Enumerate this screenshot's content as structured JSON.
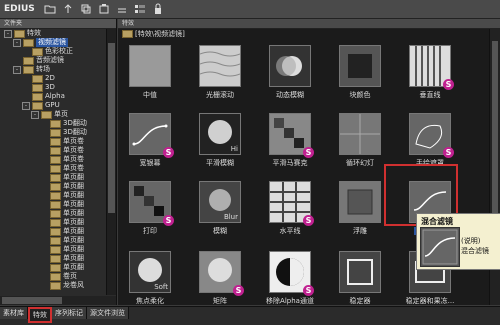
{
  "app": {
    "brand": "EDIUS"
  },
  "toolbar": [
    {
      "name": "folder-icon"
    },
    {
      "name": "up-arrow-icon"
    },
    {
      "name": "copy-icon"
    },
    {
      "name": "paste-icon"
    },
    {
      "name": "delete-icon"
    },
    {
      "name": "view-icon"
    },
    {
      "name": "lock-icon"
    }
  ],
  "left_panel": {
    "header": "文件夹",
    "tree": [
      {
        "label": "特效",
        "depth": 0,
        "expander": "-"
      },
      {
        "label": "视频滤镜",
        "depth": 1,
        "expander": "-",
        "selected": true
      },
      {
        "label": "色彩校正",
        "depth": 2,
        "expander": ""
      },
      {
        "label": "音频滤镜",
        "depth": 1,
        "expander": ""
      },
      {
        "label": "转场",
        "depth": 1,
        "expander": "-"
      },
      {
        "label": "2D",
        "depth": 2,
        "expander": ""
      },
      {
        "label": "3D",
        "depth": 2,
        "expander": ""
      },
      {
        "label": "Alpha",
        "depth": 2,
        "expander": ""
      },
      {
        "label": "GPU",
        "depth": 2,
        "expander": "-"
      },
      {
        "label": "单页",
        "depth": 3,
        "expander": "-"
      },
      {
        "label": "3D翻动",
        "depth": 4,
        "expander": ""
      },
      {
        "label": "3D翻动",
        "depth": 4,
        "expander": ""
      },
      {
        "label": "单页卷",
        "depth": 4,
        "expander": ""
      },
      {
        "label": "单页卷",
        "depth": 4,
        "expander": ""
      },
      {
        "label": "单页卷",
        "depth": 4,
        "expander": ""
      },
      {
        "label": "单页卷",
        "depth": 4,
        "expander": ""
      },
      {
        "label": "单页翻",
        "depth": 4,
        "expander": ""
      },
      {
        "label": "单页翻",
        "depth": 4,
        "expander": ""
      },
      {
        "label": "单页翻",
        "depth": 4,
        "expander": ""
      },
      {
        "label": "单页翻",
        "depth": 4,
        "expander": ""
      },
      {
        "label": "单页翻",
        "depth": 4,
        "expander": ""
      },
      {
        "label": "单页翻",
        "depth": 4,
        "expander": ""
      },
      {
        "label": "单页翻",
        "depth": 4,
        "expander": ""
      },
      {
        "label": "单页翻",
        "depth": 4,
        "expander": ""
      },
      {
        "label": "单页翻",
        "depth": 4,
        "expander": ""
      },
      {
        "label": "单页翻",
        "depth": 4,
        "expander": ""
      },
      {
        "label": "单页翻",
        "depth": 4,
        "expander": ""
      },
      {
        "label": "卷页",
        "depth": 4,
        "expander": ""
      },
      {
        "label": "龙卷风",
        "depth": 4,
        "expander": ""
      }
    ]
  },
  "right_panel": {
    "header": "特效",
    "breadcrumb": "[特效\\视频滤镜]",
    "tiles": [
      {
        "label": "中值",
        "icon": "median-thumb-icon",
        "badge": false
      },
      {
        "label": "光栅滚动",
        "icon": "raster-scroll-thumb-icon",
        "badge": false
      },
      {
        "label": "动态模糊",
        "icon": "motion-blur-thumb-icon",
        "badge": false
      },
      {
        "label": "块颜色",
        "icon": "block-color-thumb-icon",
        "badge": false
      },
      {
        "label": "垂直线",
        "icon": "vertical-lines-thumb-icon",
        "badge": true
      },
      {
        "label": "宽银幕",
        "icon": "widescreen-thumb-icon",
        "badge": true
      },
      {
        "label": "平滑模糊",
        "icon": "smooth-blur-thumb-icon",
        "badge": false,
        "corner_text": "Hi"
      },
      {
        "label": "平滑马赛克",
        "icon": "smooth-mosaic-thumb-icon",
        "badge": true
      },
      {
        "label": "循环幻灯",
        "icon": "loop-slide-thumb-icon",
        "badge": false
      },
      {
        "label": "手绘遮罩",
        "icon": "hand-drawn-mask-thumb-icon",
        "badge": true
      },
      {
        "label": "打印",
        "icon": "print-thumb-icon",
        "badge": true
      },
      {
        "label": "模糊",
        "icon": "blur-thumb-icon",
        "badge": false,
        "corner_text": "Blur"
      },
      {
        "label": "水平线",
        "icon": "horizontal-lines-thumb-icon",
        "badge": true
      },
      {
        "label": "浮雕",
        "icon": "emboss-thumb-icon",
        "badge": false
      },
      {
        "label": "混合滤镜",
        "icon": "blend-filter-thumb-icon",
        "badge": false,
        "selected": true
      },
      {
        "label": "焦点柔化",
        "icon": "focus-soften-thumb-icon",
        "badge": false,
        "corner_text": "Soft"
      },
      {
        "label": "矩阵",
        "icon": "matrix-thumb-icon",
        "badge": true
      },
      {
        "label": "移除Alpha通道",
        "icon": "remove-alpha-thumb-icon",
        "badge": true
      },
      {
        "label": "稳定器",
        "icon": "stabilizer-thumb-icon",
        "badge": false
      },
      {
        "label": "稳定器和果冻...",
        "icon": "stabilizer-jelly-thumb-icon",
        "badge": false
      }
    ]
  },
  "tooltip": {
    "title": "混合滤镜",
    "line1": "(说明)",
    "line2": "混合滤镜"
  },
  "bottom_tabs": [
    {
      "label": "素材库",
      "active": false
    },
    {
      "label": "特效",
      "active": true
    },
    {
      "label": "序列标记",
      "active": false
    },
    {
      "label": "源文件浏览",
      "active": false
    }
  ],
  "colors": {
    "selection": "#2a55a0",
    "highlight": "#d03030",
    "badge": "#c02090"
  }
}
